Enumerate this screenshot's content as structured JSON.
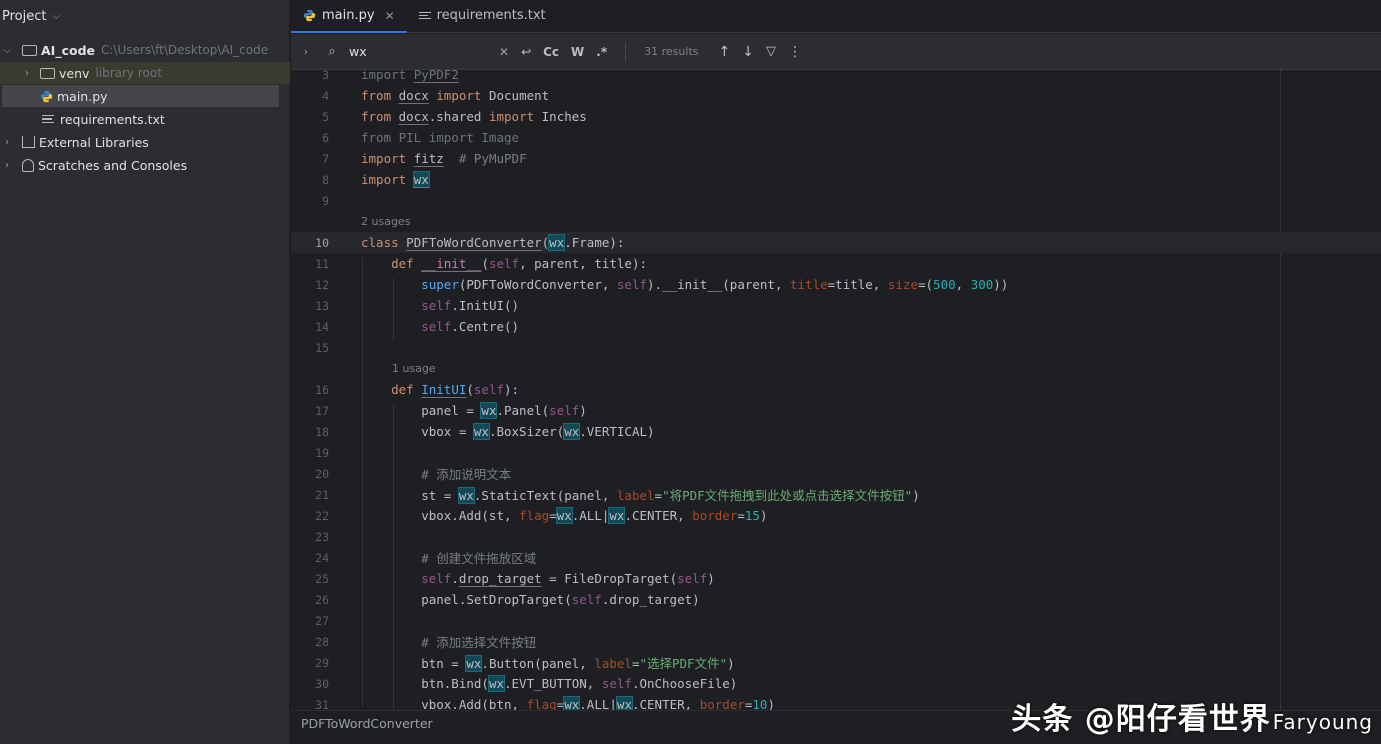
{
  "project": {
    "title": "Project",
    "root": {
      "name": "AI_code",
      "path": "C:\\Users\\ft\\Desktop\\AI_code"
    },
    "venv": {
      "name": "venv",
      "hint": "library root"
    },
    "files": [
      "main.py",
      "requirements.txt"
    ],
    "external_libraries": "External Libraries",
    "scratches": "Scratches and Consoles"
  },
  "tabs": [
    {
      "label": "main.py",
      "active": true
    },
    {
      "label": "requirements.txt",
      "active": false
    }
  ],
  "find": {
    "value": "wx",
    "case_label": "Cc",
    "word_label": "W",
    "regex_label": ".*",
    "results": "31 results"
  },
  "code": {
    "hints": {
      "usages2": "2 usages",
      "usage1": "1 usage"
    },
    "comments": {
      "c20": "# 添加说明文本",
      "c24": "# 创建文件拖放区域",
      "c28": "# 添加选择文件按钮",
      "pymupdf": "# PyMuPDF"
    },
    "strings": {
      "drag_label": "\"将PDF文件拖拽到此处或点击选择文件按钮\"",
      "choose_label": "\"选择PDF文件\""
    },
    "numbers": {
      "w": "500",
      "h": "300",
      "border15": "15",
      "border10": "10"
    }
  },
  "breadcrumb": "PDFToWordConverter",
  "watermark": {
    "main": "头条 @阳仔看世界",
    "sub": "Faryoung"
  }
}
